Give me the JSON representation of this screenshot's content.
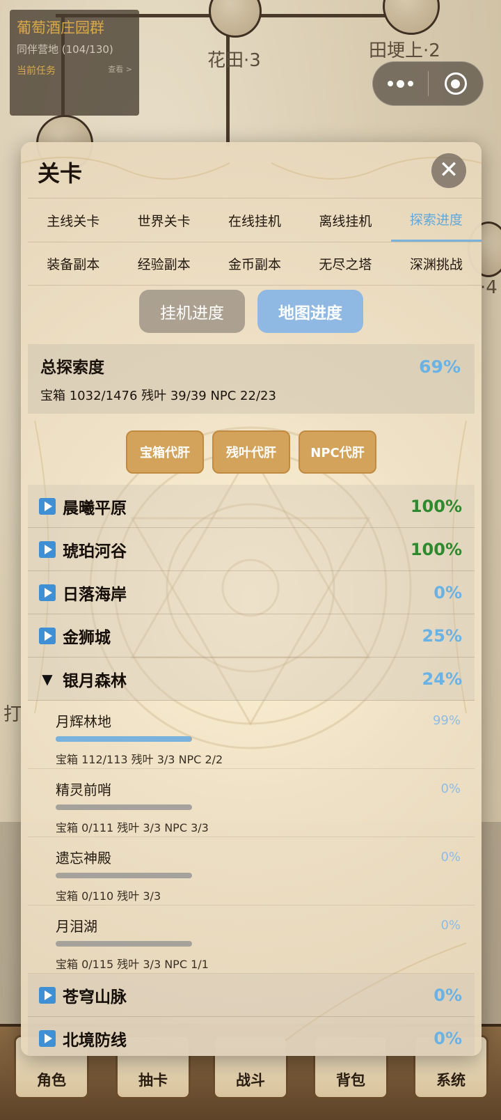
{
  "map": {
    "labels": [
      "花田·3",
      "田埂上·2",
      "·4",
      "打"
    ]
  },
  "task_card": {
    "title": "葡萄酒庄园群",
    "subtitle": "同伴营地 (104/130)",
    "task_link": "当前任务",
    "more": "查看 >"
  },
  "modal": {
    "title": "关卡",
    "close": "✕",
    "tabs_row1": [
      "主线关卡",
      "世界关卡",
      "在线挂机",
      "离线挂机",
      "探索进度"
    ],
    "tabs_row2": [
      "装备副本",
      "经验副本",
      "金币副本",
      "无尽之塔",
      "深渊挑战"
    ],
    "active_tab": "探索进度",
    "segments": [
      "挂机进度",
      "地图进度"
    ],
    "active_segment": "地图进度",
    "summary": {
      "title": "总探索度",
      "percent": "69%",
      "stats": "宝箱 1032/1476  残叶 39/39  NPC 22/23"
    },
    "actions": [
      "宝箱代肝",
      "残叶代肝",
      "NPC代肝"
    ],
    "regions": [
      {
        "name": "晨曦平原",
        "percent": "100%",
        "color": "green",
        "expanded": false
      },
      {
        "name": "琥珀河谷",
        "percent": "100%",
        "color": "green",
        "expanded": false
      },
      {
        "name": "日落海岸",
        "percent": "0%",
        "color": "blue",
        "expanded": false
      },
      {
        "name": "金狮城",
        "percent": "25%",
        "color": "blue",
        "expanded": false
      },
      {
        "name": "银月森林",
        "percent": "24%",
        "color": "blue",
        "expanded": true
      },
      {
        "name": "苍穹山脉",
        "percent": "0%",
        "color": "blue",
        "expanded": false
      },
      {
        "name": "北境防线",
        "percent": "0%",
        "color": "blue",
        "expanded": false
      }
    ],
    "sub_areas": [
      {
        "name": "月辉林地",
        "percent": "99%",
        "progress": 0.99,
        "stats": "宝箱 112/113  残叶 3/3  NPC 2/2"
      },
      {
        "name": "精灵前哨",
        "percent": "0%",
        "progress": 0,
        "stats": "宝箱 0/111  残叶 3/3  NPC 3/3"
      },
      {
        "name": "遗忘神殿",
        "percent": "0%",
        "progress": 0,
        "stats": "宝箱 0/110  残叶 3/3"
      },
      {
        "name": "月泪湖",
        "percent": "0%",
        "progress": 0,
        "stats": "宝箱 0/115  残叶 3/3  NPC 1/1"
      }
    ]
  },
  "bottom_nav": [
    "角色",
    "抽卡",
    "战斗",
    "背包",
    "系统"
  ],
  "colors": {
    "accent_blue": "#6bb2e4",
    "complete_green": "#2f8a2f",
    "action_gold": "#d4a35b"
  },
  "icons": [
    "close-icon",
    "more-dots-icon",
    "target-icon",
    "expand-triangle-icon",
    "collapse-triangle-icon"
  ]
}
